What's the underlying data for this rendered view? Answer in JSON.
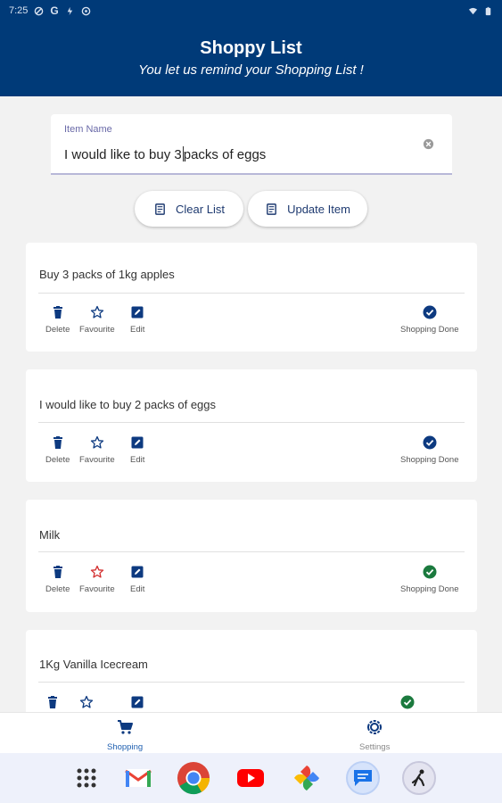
{
  "status_bar": {
    "time": "7:25"
  },
  "header": {
    "title": "Shoppy List",
    "subtitle": "You let us remind your Shopping List !"
  },
  "input": {
    "label": "Item Name",
    "value_before_caret": "I would like to buy 3",
    "value_after_caret": "packs of eggs"
  },
  "buttons": {
    "clear_list": "Clear List",
    "update_item": "Update Item"
  },
  "actions": {
    "delete": "Delete",
    "favourite": "Favourite",
    "edit": "Edit",
    "done": "Shopping Done"
  },
  "items": [
    {
      "text": "Buy 3 packs of 1kg apples",
      "favourite": false,
      "done": false
    },
    {
      "text": "I would like to buy 2 packs of eggs",
      "favourite": false,
      "done": false
    },
    {
      "text": "Milk",
      "favourite": true,
      "done": true
    },
    {
      "text": "1Kg Vanilla Icecream",
      "favourite": false,
      "done": true
    }
  ],
  "bottom_nav": {
    "shopping": "Shopping",
    "settings": "Settings"
  },
  "colors": {
    "primary": "#003a78",
    "accent_blue": "#1e3a70",
    "favourite_red": "#d32f2f",
    "done_green": "#1b7a3e",
    "done_blue": "#0d3a80"
  },
  "dock_apps": [
    "apps-grid-icon",
    "gmail-icon",
    "chrome-icon",
    "youtube-icon",
    "photos-icon",
    "messages-icon",
    "app-icon"
  ]
}
